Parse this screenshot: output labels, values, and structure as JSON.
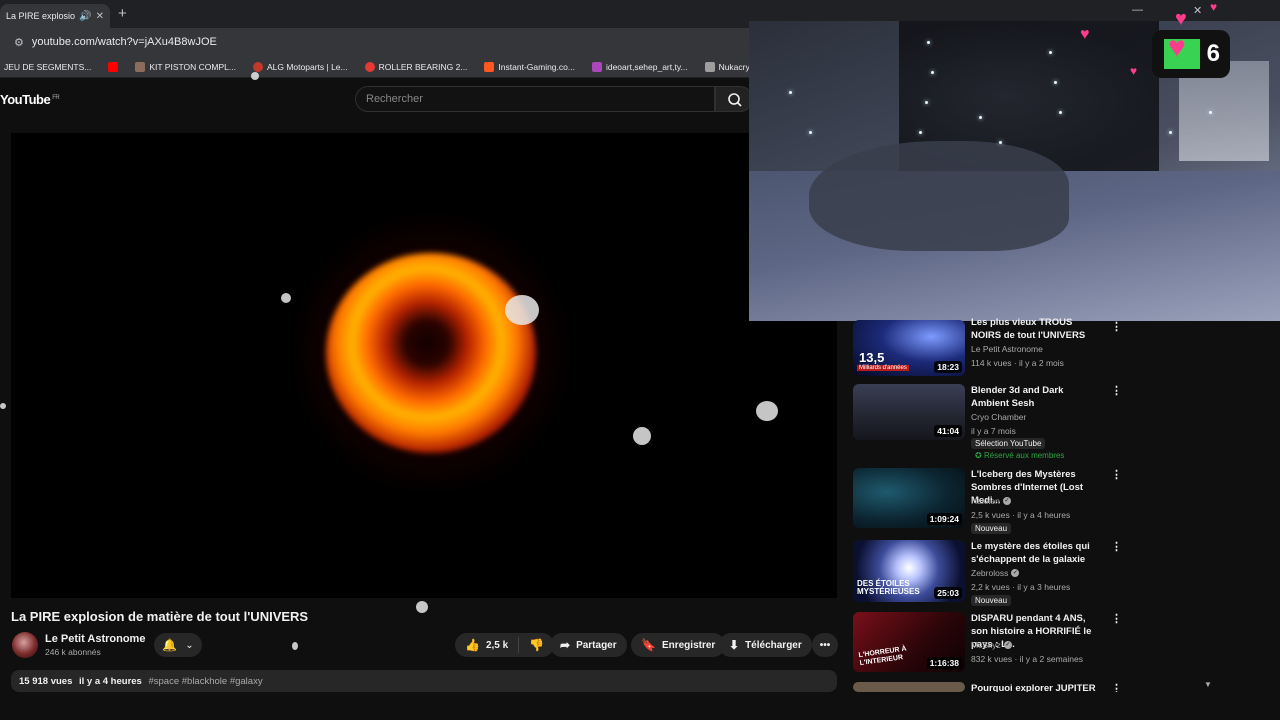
{
  "browser": {
    "tab_title": "La PIRE explosion de mat",
    "url": "youtube.com/watch?v=jAXu4B8wJOE",
    "bookmarks": [
      {
        "label": "JEU DE SEGMENTS...",
        "color": "#5f6368"
      },
      {
        "label": "",
        "color": "#ff0000"
      },
      {
        "label": "KIT PISTON COMPL...",
        "color": "#8a6d5a"
      },
      {
        "label": "ALG Motoparts | Le...",
        "color": "#c0392b"
      },
      {
        "label": "ROLLER BEARING 2...",
        "color": "#e53935"
      },
      {
        "label": "Instant-Gaming.co...",
        "color": "#ff5722"
      },
      {
        "label": "ideoart,sehep_art,ty...",
        "color": "#ab47bc"
      },
      {
        "label": "Nukacrypt - All Thin...",
        "color": "#9e9e9e"
      }
    ]
  },
  "youtube": {
    "logo": "YouTube",
    "region": "FR",
    "search_placeholder": "Rechercher"
  },
  "video": {
    "title": "La PIRE explosion de matière de tout l'UNIVERS",
    "channel": "Le Petit Astronome",
    "subscribers": "246 k abonnés",
    "likes": "2,5 k",
    "share_label": "Partager",
    "save_label": "Enregistrer",
    "download_label": "Télécharger",
    "views": "15 918 vues",
    "age": "il y a 4 heures",
    "tags": "#space #blackhole #galaxy"
  },
  "overlay": {
    "heart_count": "6"
  },
  "recommendations": [
    {
      "title": "Les plus vieux TROUS NOIRS de tout l'UNIVERS",
      "channel": "Le Petit Astronome",
      "meta": "114 k vues · il y a 2 mois",
      "duration": "18:23",
      "thumb_text": "13,5",
      "thumb_sub": "Milliards d'années",
      "verified": false,
      "badges": []
    },
    {
      "title": "Blender 3d and Dark Ambient Sesh",
      "channel": "Cryo Chamber",
      "meta": "il y a 7 mois",
      "duration": "41:04",
      "verified": false,
      "badges": [
        "Sélection YouTube",
        "Réservé aux membres"
      ]
    },
    {
      "title": "L'Iceberg des Mystères Sombres d'Internet (Lost Medi...",
      "channel": "Hakken",
      "meta": "2,5 k vues · il y a 4 heures",
      "duration": "1:09:24",
      "verified": true,
      "badges": [
        "Nouveau"
      ]
    },
    {
      "title": "Le mystère des étoiles qui s'échappent de la galaxie",
      "channel": "Zebroloss",
      "meta": "2,2 k vues · il y a 3 heures",
      "duration": "25:03",
      "thumb_text": "DES ÉTOILES MYSTÉRIEUSES",
      "verified": true,
      "badges": [
        "Nouveau"
      ]
    },
    {
      "title": "DISPARU pendant 4 ANS, son histoire a HORRIFIÉ le pays : L...",
      "channel": "McSkyz",
      "meta": "832 k vues · il y a 2 semaines",
      "duration": "1:16:38",
      "thumb_text": "L'HORREUR À L'INTERIEUR",
      "verified": true,
      "badges": []
    },
    {
      "title": "Pourquoi explorer JUPITER est",
      "channel": "",
      "meta": "",
      "duration": "",
      "verified": false,
      "badges": []
    }
  ]
}
